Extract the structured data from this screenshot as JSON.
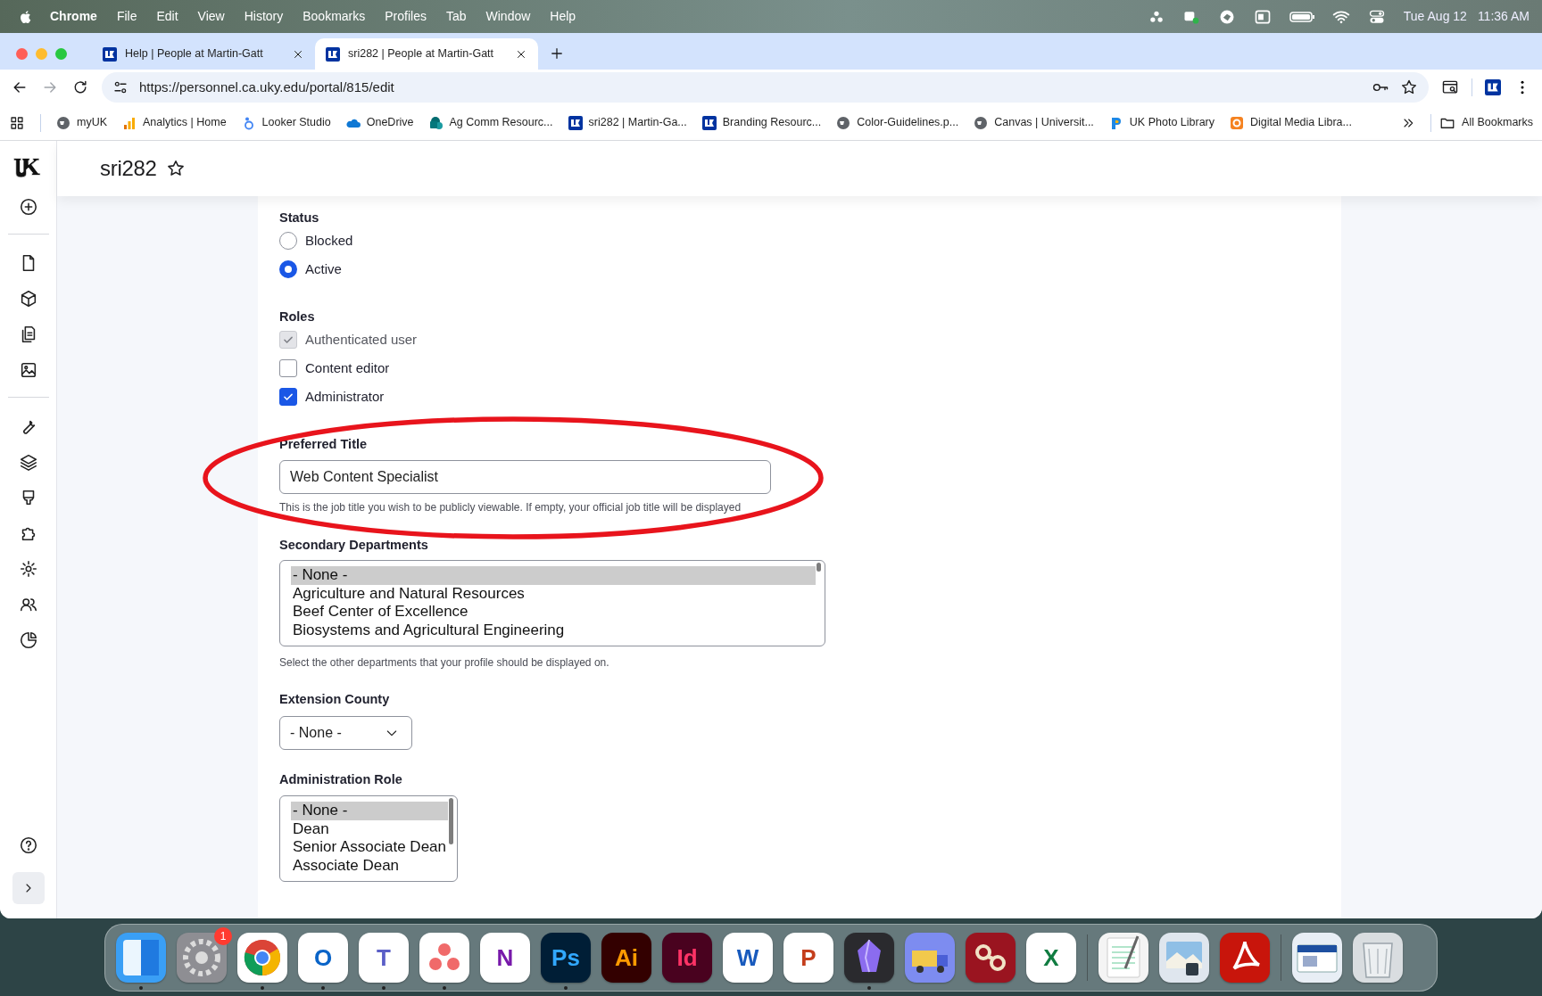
{
  "menu_bar": {
    "app": "Chrome",
    "menus": [
      "File",
      "Edit",
      "View",
      "History",
      "Bookmarks",
      "Profiles",
      "Tab",
      "Window",
      "Help"
    ],
    "date": "Tue Aug 12",
    "time": "11:36 AM"
  },
  "tabs": [
    {
      "title": "Help | People at Martin-Gatt",
      "selected": false
    },
    {
      "title": "sri282 | People at Martin-Gatt",
      "selected": true
    }
  ],
  "address": "https://personnel.ca.uky.edu/portal/815/edit",
  "bookmarks": [
    {
      "label": "myUK"
    },
    {
      "label": "Analytics | Home"
    },
    {
      "label": "Looker Studio"
    },
    {
      "label": "OneDrive"
    },
    {
      "label": "Ag Comm Resourc..."
    },
    {
      "label": "sri282 | Martin-Ga..."
    },
    {
      "label": "Branding Resourc..."
    },
    {
      "label": "Color-Guidelines.p..."
    },
    {
      "label": "Canvas | Universit..."
    },
    {
      "label": "UK Photo Library"
    },
    {
      "label": "Digital Media Libra..."
    }
  ],
  "all_bookmarks": "All Bookmarks",
  "page": {
    "title": "sri282",
    "status": {
      "label": "Status",
      "options": [
        {
          "label": "Blocked",
          "selected": false
        },
        {
          "label": "Active",
          "selected": true
        }
      ]
    },
    "roles": {
      "label": "Roles",
      "options": [
        {
          "label": "Authenticated user",
          "checked": true,
          "disabled": true
        },
        {
          "label": "Content editor",
          "checked": false,
          "disabled": false
        },
        {
          "label": "Administrator",
          "checked": true,
          "disabled": false
        }
      ]
    },
    "preferred_title": {
      "label": "Preferred Title",
      "value": "Web Content Specialist",
      "help": "This is the job title you wish to be publicly viewable. If empty, your official job title will be displayed"
    },
    "secondary_departments": {
      "label": "Secondary Departments",
      "options": [
        {
          "label": "- None -",
          "selected": true
        },
        {
          "label": "Agriculture and Natural Resources",
          "selected": false
        },
        {
          "label": "Beef Center of Excellence",
          "selected": false
        },
        {
          "label": "Biosystems and Agricultural Engineering",
          "selected": false
        }
      ],
      "help": "Select the other departments that your profile should be displayed on."
    },
    "extension_county": {
      "label": "Extension County",
      "value": "- None -"
    },
    "administration_role": {
      "label": "Administration Role",
      "options": [
        {
          "label": "- None -",
          "selected": true
        },
        {
          "label": "Dean",
          "selected": false
        },
        {
          "label": "Senior Associate Dean",
          "selected": false
        },
        {
          "label": "Associate Dean",
          "selected": false
        }
      ]
    }
  },
  "annotation": {
    "kind": "ellipse",
    "color": "#e8141c"
  },
  "dock": [
    {
      "color": "#3a9ff5",
      "running": true
    },
    {
      "color": "#8e8e93",
      "badge": "1",
      "running": false
    },
    {
      "color": "#ffffff",
      "running": true
    },
    {
      "color": "#ffffff",
      "glyph": "O",
      "running": true
    },
    {
      "color": "#ffffff",
      "glyph": "T",
      "running": true
    },
    {
      "color": "#ffffff",
      "running": true
    },
    {
      "color": "#ffffff",
      "glyph": "N",
      "running": false
    },
    {
      "color": "#001e36",
      "glyph": "Ps",
      "running": true
    },
    {
      "color": "#330000",
      "glyph": "Ai",
      "running": false
    },
    {
      "color": "#49021f",
      "glyph": "Id",
      "running": false
    },
    {
      "color": "#ffffff",
      "glyph": "W",
      "running": false
    },
    {
      "color": "#ffffff",
      "glyph": "P",
      "running": false
    },
    {
      "color": "#2a2a2e",
      "running": true
    },
    {
      "color": "#7d8cf0",
      "running": false
    },
    {
      "color": "#9a1420",
      "running": false
    },
    {
      "color": "#ffffff",
      "glyph": "X",
      "running": false
    },
    {
      "color": "#f4f4f4",
      "running": false
    },
    {
      "color": "#dfe6ee",
      "running": false
    },
    {
      "color": "#c8150b",
      "running": false
    },
    {
      "color": "#e8eef5",
      "running": false
    },
    {
      "color": "#d9dde0",
      "running": false
    }
  ]
}
